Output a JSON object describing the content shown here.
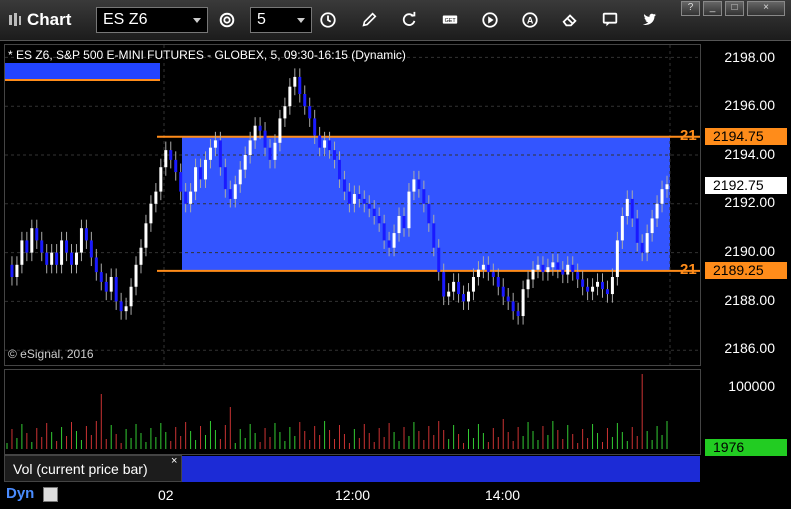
{
  "app": {
    "title": "Chart"
  },
  "toolbar": {
    "symbol": "ES Z6",
    "interval": "5",
    "buttons": [
      "settings-icon",
      "clock-icon",
      "pencil-icon",
      "refresh-icon",
      "get-icon",
      "play-icon",
      "a-icon",
      "eraser-icon",
      "comment-icon",
      "twitter-icon"
    ]
  },
  "window_controls": [
    "?",
    "_",
    "□",
    "×"
  ],
  "chart": {
    "header": "* ES Z6, S&P 500 E-MINI FUTURES - GLOBEX, 5, 09:30-16:15 (Dynamic)",
    "copyright": "© eSignal, 2016",
    "y_axis_labels": [
      "2198.00",
      "2196.00",
      "2194.00",
      "2192.00",
      "2190.00",
      "2188.00",
      "2186.00"
    ],
    "price_tags": {
      "upper_line": "2194.75",
      "current_price": "2192.75",
      "lower_line": "2189.25"
    },
    "side_labels": {
      "upper": "21",
      "lower": "21"
    },
    "x_axis_labels": [
      "02",
      "12:00",
      "14:00"
    ],
    "colors": {
      "up": "#ffffff",
      "down": "#1a1aff",
      "zone": "#3355ff",
      "level": "#ff8c1a",
      "vol_up": "#33cc33",
      "vol_down": "#cc3333"
    }
  },
  "volume": {
    "label": "Vol (current price bar)",
    "close": "×",
    "y_axis_label": "100000",
    "current_value": "1976"
  },
  "footer": {
    "mode": "Dyn"
  }
}
